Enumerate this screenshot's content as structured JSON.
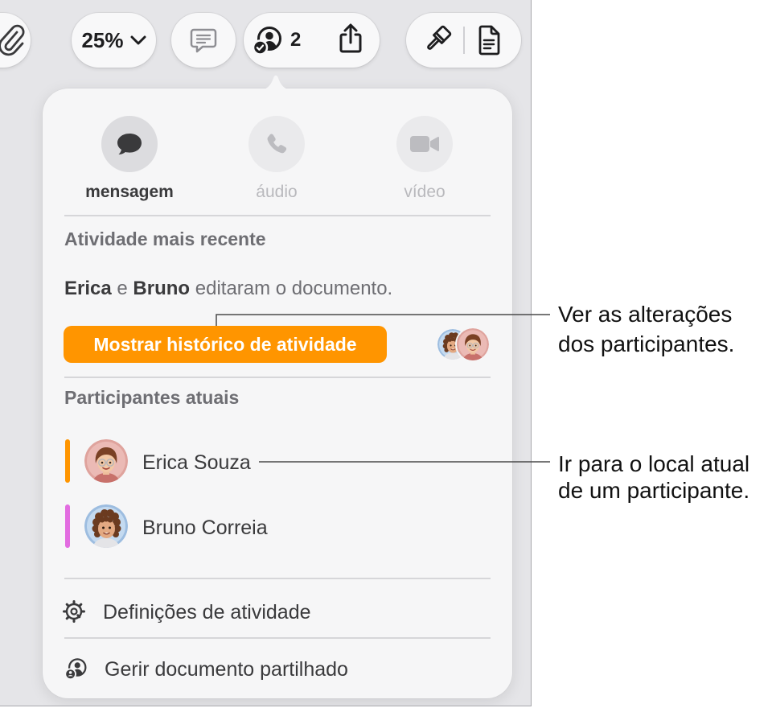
{
  "toolbar": {
    "zoom_label": "25%",
    "collaborators_count": "2"
  },
  "popover": {
    "actions": [
      {
        "label": "mensagem",
        "icon": "message-icon",
        "enabled": true
      },
      {
        "label": "áudio",
        "icon": "phone-icon",
        "enabled": false
      },
      {
        "label": "vídeo",
        "icon": "video-icon",
        "enabled": false
      }
    ],
    "recent_activity": {
      "heading": "Atividade mais recente",
      "editor_1": "Erica",
      "conjunction": "e",
      "editor_2": "Bruno",
      "summary_rest": "editaram o documento.",
      "button_label": "Mostrar histórico de atividade"
    },
    "participants": {
      "heading": "Participantes atuais",
      "items": [
        {
          "name": "Erica Souza",
          "color": "#ff9500"
        },
        {
          "name": "Bruno Correia",
          "color": "#e26ce0"
        }
      ]
    },
    "menu": [
      {
        "label": "Definições de atividade",
        "icon": "activity-settings-icon"
      },
      {
        "label": "Gerir documento partilhado",
        "icon": "manage-shared-document-icon"
      }
    ]
  },
  "callouts": [
    {
      "line_1": "Ver as alterações",
      "line_2": "dos participantes."
    },
    {
      "line_1": "Ir para o local atual",
      "line_2": "de um participante."
    }
  ],
  "colors": {
    "accent": "#ff9500"
  }
}
